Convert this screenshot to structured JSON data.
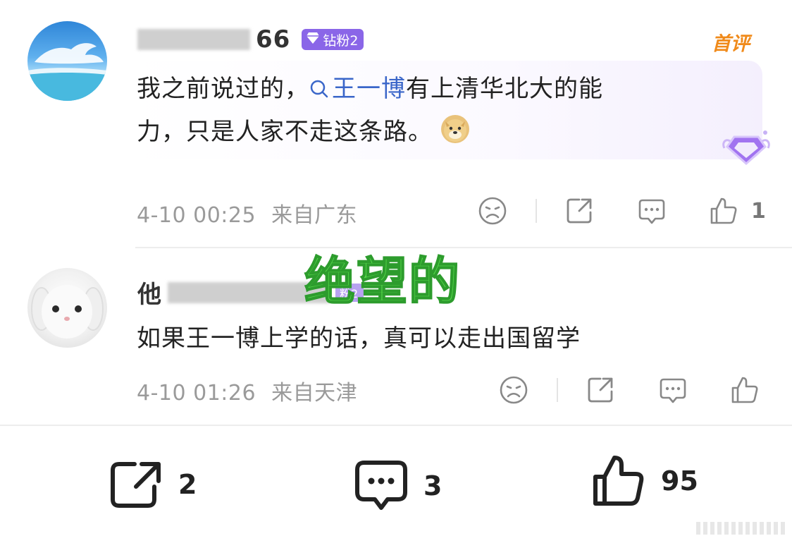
{
  "comments": [
    {
      "username_visible": "66",
      "badge_label": "钻粉2",
      "first_tag": "首评",
      "text_before": "我之前说过的，",
      "topic_text": "王一博",
      "text_after_line1": "有上清华北大的能",
      "text_line2": "力，只是人家不走这条路。",
      "emoji": "🐶",
      "time": "4-10 00:25",
      "location": "来自广东",
      "like_count": "1"
    },
    {
      "username_visible": "他",
      "badge_label": "粉2",
      "text": "如果王一博上学的话，真可以走出国留学",
      "time": "4-10 01:26",
      "location": "来自天津"
    }
  ],
  "overlay_text": "绝望的",
  "footer": {
    "share_count": "2",
    "comment_count": "3",
    "like_count": "95"
  },
  "colors": {
    "badge": "#8a66e8",
    "first_tag": "#f08a1a",
    "topic": "#3a66c9",
    "watermark": "#55d94a"
  },
  "icons": [
    "dislike-face-icon",
    "share-icon",
    "comment-icon",
    "thumbs-up-icon",
    "diamond-badge-icon",
    "search-topic-icon"
  ]
}
